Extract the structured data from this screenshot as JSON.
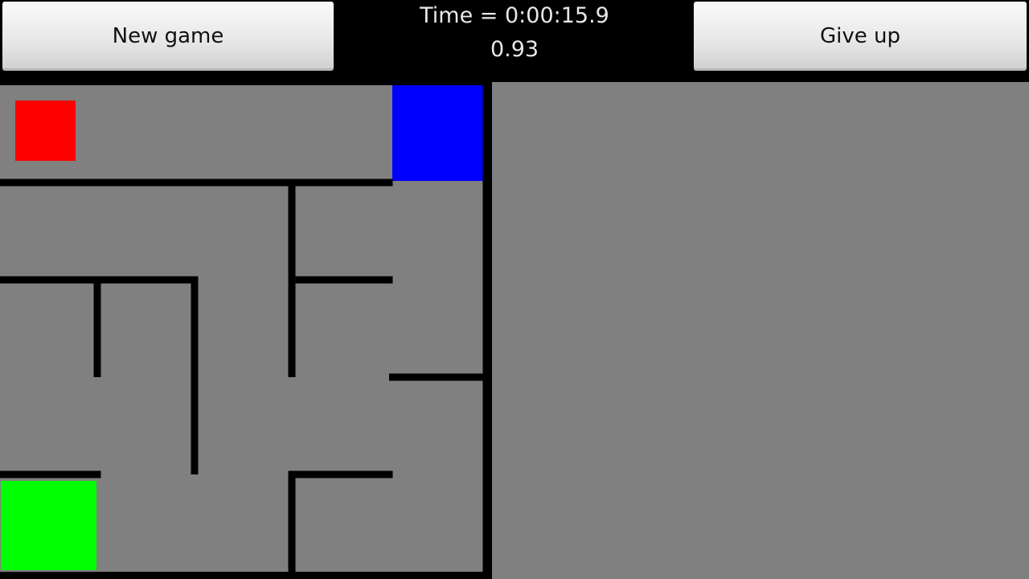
{
  "header": {
    "new_game_label": "New game",
    "give_up_label": "Give up",
    "timer_text": "Time = 0:00:15.9",
    "score_text": "0.93"
  },
  "maze": {
    "rows": 5,
    "cols": 5,
    "colors": {
      "floor": "#808080",
      "wall": "#000000",
      "player": "#ff0000",
      "goal": "#0000ff",
      "start": "#00ff00",
      "side_panel": "#808080"
    },
    "player": {
      "row": 0,
      "col": 0
    },
    "goal": {
      "row": 0,
      "col": 4
    },
    "start": {
      "row": 4,
      "col": 0
    },
    "horizontal_walls": [
      {
        "row_line": 1,
        "col_start": 0,
        "col_end": 4
      },
      {
        "row_line": 2,
        "col_start": 0,
        "col_end": 2
      },
      {
        "row_line": 2,
        "col_start": 3,
        "col_end": 4
      },
      {
        "row_line": 3,
        "col_start": 4,
        "col_end": 5
      },
      {
        "row_line": 4,
        "col_start": 0,
        "col_end": 1
      },
      {
        "row_line": 4,
        "col_start": 3,
        "col_end": 4
      }
    ],
    "vertical_walls": [
      {
        "col_line": 1,
        "row_start": 2,
        "row_end": 3
      },
      {
        "col_line": 2,
        "row_start": 2,
        "row_end": 4
      },
      {
        "col_line": 3,
        "row_start": 1,
        "row_end": 3
      },
      {
        "col_line": 3,
        "row_start": 4,
        "row_end": 5
      },
      {
        "col_line": 5,
        "row_start": 0,
        "row_end": 5
      }
    ]
  }
}
